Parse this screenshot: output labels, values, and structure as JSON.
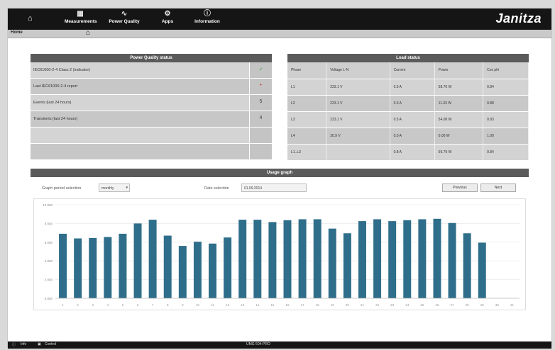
{
  "nav": {
    "items": [
      {
        "label": "Measurements",
        "icon": "grid-icon"
      },
      {
        "label": "Power Quality",
        "icon": "wave-icon"
      },
      {
        "label": "Apps",
        "icon": "gear-icon"
      },
      {
        "label": "Information",
        "icon": "info-icon"
      }
    ],
    "logo": "Janitza"
  },
  "breadcrumb": {
    "label": "Home"
  },
  "power_quality": {
    "title": "Power Quality status",
    "rows": [
      {
        "text": "IEC61000-2-4 Class 2 (indicator)",
        "status": "✓"
      },
      {
        "text": "Last IEC61000-2-4 report",
        "status": "•"
      },
      {
        "text": "Events (last 24 hours)",
        "status": "5"
      },
      {
        "text": "Transients (last 24 hours)",
        "status": "4"
      },
      {
        "text": "",
        "status": ""
      },
      {
        "text": "",
        "status": ""
      }
    ]
  },
  "load": {
    "title": "Load status",
    "headers": [
      "Phase",
      "Voltage L-N",
      "Current",
      "Power",
      "Cos phi"
    ],
    "rows": [
      [
        "L1",
        "223.1 V",
        "0.5 A",
        "58.76 W",
        "0.84"
      ],
      [
        "L2",
        "223.1 V",
        "0.3 A",
        "11.33 W",
        "0.88"
      ],
      [
        "L3",
        "223.1 V",
        "0.5 A",
        "54.08 W",
        "0.93"
      ],
      [
        "L4",
        "20.9 V",
        "0.0 A",
        "0.00 W",
        "1.00"
      ],
      [
        "L1..L3",
        "",
        "0.8 A",
        "59.79 W",
        "0.84"
      ]
    ]
  },
  "usage": {
    "title": "Usage graph",
    "period_label": "Graph period selection",
    "period_value": "monthly",
    "date_label": "Date selection",
    "date_value": "01.09.2014",
    "prev_label": "Previous",
    "next_label": "Next"
  },
  "chart_data": {
    "type": "bar",
    "categories": [
      "1",
      "2",
      "3",
      "4",
      "5",
      "6",
      "7",
      "8",
      "9",
      "10",
      "11",
      "12",
      "13",
      "14",
      "15",
      "16",
      "17",
      "18",
      "19",
      "20",
      "21",
      "22",
      "23",
      "24",
      "25",
      "26",
      "27",
      "28",
      "29",
      "30",
      "31"
    ],
    "values": [
      6.9,
      6.4,
      6.45,
      6.55,
      6.9,
      8.0,
      8.4,
      6.7,
      5.6,
      6.05,
      5.85,
      6.5,
      8.4,
      8.4,
      8.15,
      8.35,
      8.45,
      8.45,
      7.45,
      6.95,
      8.25,
      8.45,
      8.25,
      8.35,
      8.45,
      8.5,
      8.05,
      6.95,
      5.95,
      0,
      0
    ],
    "ylim": [
      0,
      10
    ],
    "yticks": [
      "0.000",
      "2.000",
      "4.000",
      "6.000",
      "8.000",
      "10.000"
    ],
    "bar_color": "#2f6e8a"
  },
  "status_bar": {
    "left1": "Info",
    "left2": "Control",
    "center": "UMG 604-PRO"
  }
}
